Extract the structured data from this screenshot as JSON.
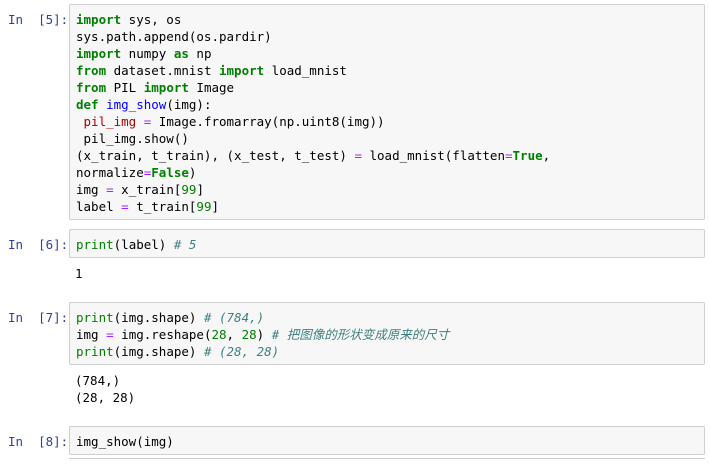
{
  "cells": [
    {
      "prompt": "In  [5]:",
      "lines": [
        [
          {
            "t": "import",
            "c": "kw"
          },
          {
            "t": " sys, os",
            "c": ""
          }
        ],
        [
          {
            "t": "sys.path.append(os.pardir)",
            "c": ""
          }
        ],
        [
          {
            "t": "import",
            "c": "kw"
          },
          {
            "t": " numpy ",
            "c": ""
          },
          {
            "t": "as",
            "c": "kw"
          },
          {
            "t": " np",
            "c": ""
          }
        ],
        [
          {
            "t": "from",
            "c": "kw"
          },
          {
            "t": " dataset.mnist ",
            "c": ""
          },
          {
            "t": "import",
            "c": "kw"
          },
          {
            "t": " load_mnist",
            "c": ""
          }
        ],
        [
          {
            "t": "from",
            "c": "kw"
          },
          {
            "t": " PIL ",
            "c": ""
          },
          {
            "t": "import",
            "c": "kw"
          },
          {
            "t": " Image",
            "c": ""
          }
        ],
        [
          {
            "t": "def",
            "c": "kw"
          },
          {
            "t": " ",
            "c": ""
          },
          {
            "t": "img_show",
            "c": "fn"
          },
          {
            "t": "(img):",
            "c": ""
          }
        ],
        [
          {
            "t": " pil_img ",
            "c": "red"
          },
          {
            "t": "=",
            "c": "op"
          },
          {
            "t": " Image.fromarray(np.uint8(img))",
            "c": ""
          }
        ],
        [
          {
            "t": " pil_img.show()",
            "c": ""
          }
        ],
        [
          {
            "t": "(x_train, t_train), (x_test, t_test) ",
            "c": ""
          },
          {
            "t": "=",
            "c": "op"
          },
          {
            "t": " load_mnist(flatten",
            "c": ""
          },
          {
            "t": "=",
            "c": "op"
          },
          {
            "t": "True",
            "c": "kw"
          },
          {
            "t": ",",
            "c": ""
          }
        ],
        [
          {
            "t": "normalize",
            "c": ""
          },
          {
            "t": "=",
            "c": "op"
          },
          {
            "t": "False",
            "c": "kw"
          },
          {
            "t": ")",
            "c": ""
          }
        ],
        [
          {
            "t": "img ",
            "c": ""
          },
          {
            "t": "=",
            "c": "op"
          },
          {
            "t": " x_train[",
            "c": ""
          },
          {
            "t": "99",
            "c": "num"
          },
          {
            "t": "]",
            "c": ""
          }
        ],
        [
          {
            "t": "label ",
            "c": ""
          },
          {
            "t": "=",
            "c": "op"
          },
          {
            "t": " t_train[",
            "c": ""
          },
          {
            "t": "99",
            "c": "num"
          },
          {
            "t": "]",
            "c": ""
          }
        ]
      ],
      "output": []
    },
    {
      "prompt": "In  [6]:",
      "lines": [
        [
          {
            "t": "print",
            "c": "bi"
          },
          {
            "t": "(label) ",
            "c": ""
          },
          {
            "t": "# 5",
            "c": "cm"
          }
        ]
      ],
      "output": [
        "1"
      ]
    },
    {
      "prompt": "In  [7]:",
      "lines": [
        [
          {
            "t": "print",
            "c": "bi"
          },
          {
            "t": "(img.shape) ",
            "c": ""
          },
          {
            "t": "# (784,)",
            "c": "cm"
          }
        ],
        [
          {
            "t": "img ",
            "c": ""
          },
          {
            "t": "=",
            "c": "op"
          },
          {
            "t": " img.reshape(",
            "c": ""
          },
          {
            "t": "28",
            "c": "num"
          },
          {
            "t": ", ",
            "c": ""
          },
          {
            "t": "28",
            "c": "num"
          },
          {
            "t": ") ",
            "c": ""
          },
          {
            "t": "# 把图像的形状变成原来的尺寸",
            "c": "cm"
          }
        ],
        [
          {
            "t": "print",
            "c": "bi"
          },
          {
            "t": "(img.shape) ",
            "c": ""
          },
          {
            "t": "# (28, 28)",
            "c": "cm"
          }
        ]
      ],
      "output": [
        "(784,)",
        "(28, 28)"
      ]
    },
    {
      "prompt": "In  [8]:",
      "lines": [
        [
          {
            "t": "img_show(img)",
            "c": ""
          }
        ]
      ],
      "output": []
    }
  ]
}
